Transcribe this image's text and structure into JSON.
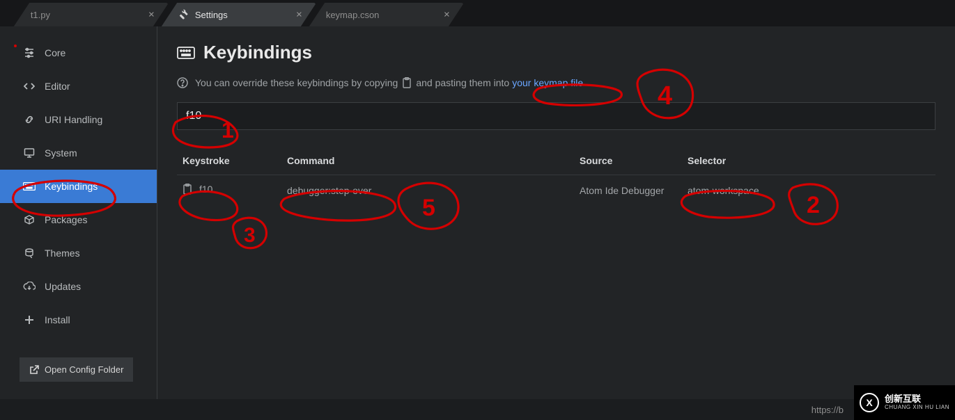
{
  "tabs": [
    {
      "label": "t1.py",
      "active": false
    },
    {
      "label": "Settings",
      "active": true
    },
    {
      "label": "keymap.cson",
      "active": false
    }
  ],
  "sidebar": {
    "items": [
      {
        "label": "Core",
        "icon": "sliders-icon"
      },
      {
        "label": "Editor",
        "icon": "code-icon"
      },
      {
        "label": "URI Handling",
        "icon": "link-icon"
      },
      {
        "label": "System",
        "icon": "monitor-icon"
      },
      {
        "label": "Keybindings",
        "icon": "keyboard-icon",
        "active": true
      },
      {
        "label": "Packages",
        "icon": "package-icon"
      },
      {
        "label": "Themes",
        "icon": "paintcan-icon"
      },
      {
        "label": "Updates",
        "icon": "cloud-download-icon"
      },
      {
        "label": "Install",
        "icon": "plus-icon"
      }
    ],
    "open_config_label": "Open Config Folder"
  },
  "keybindings": {
    "title": "Keybindings",
    "hint_prefix": "You can override these keybindings by copying",
    "hint_mid": "and pasting them into",
    "hint_link": "your keymap file",
    "search_value": "f10",
    "columns": {
      "keystroke": "Keystroke",
      "command": "Command",
      "source": "Source",
      "selector": "Selector"
    },
    "rows": [
      {
        "keystroke": "f10",
        "command": "debugger:step-over",
        "source": "Atom Ide Debugger",
        "selector": "atom-workspace"
      }
    ]
  },
  "footer": {
    "url_fragment": "https://b"
  },
  "watermark": {
    "cn": "创新互联",
    "py": "CHUANG XIN HU LIAN"
  },
  "annotations": [
    "1",
    "2",
    "3",
    "4",
    "5"
  ]
}
